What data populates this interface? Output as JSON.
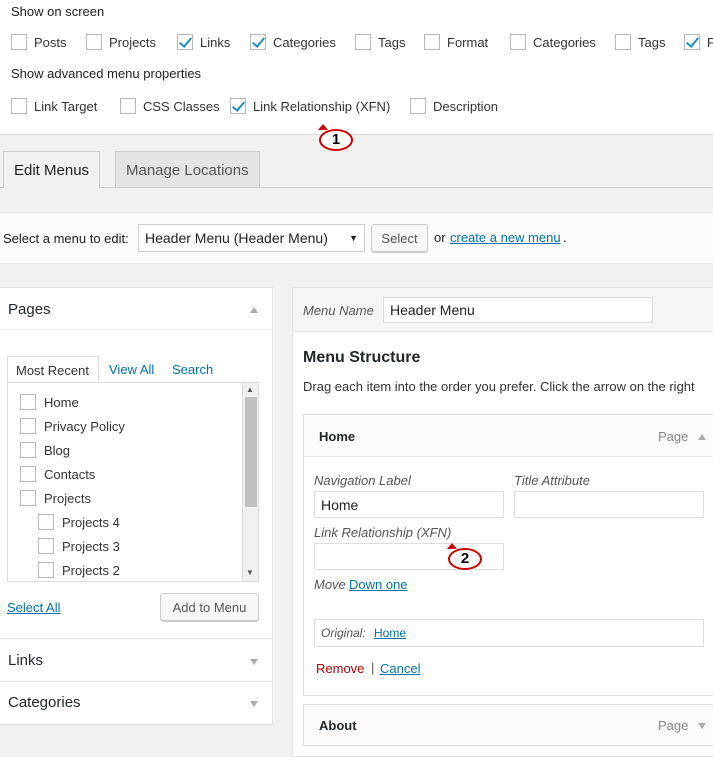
{
  "screen_options": {
    "show_on_screen_heading": "Show on screen",
    "items": [
      {
        "label": "Posts",
        "checked": false
      },
      {
        "label": "Projects",
        "checked": false
      },
      {
        "label": "Links",
        "checked": true
      },
      {
        "label": "Categories",
        "checked": true
      },
      {
        "label": "Tags",
        "checked": false
      },
      {
        "label": "Format",
        "checked": false
      },
      {
        "label": "Categories",
        "checked": false
      },
      {
        "label": "Tags",
        "checked": false
      },
      {
        "label": "P",
        "checked": true
      }
    ],
    "advanced_heading": "Show advanced menu properties",
    "advanced_items": [
      {
        "label": "Link Target",
        "checked": false
      },
      {
        "label": "CSS Classes",
        "checked": false
      },
      {
        "label": "Link Relationship (XFN)",
        "checked": true
      },
      {
        "label": "Description",
        "checked": false
      }
    ]
  },
  "callouts": {
    "one": "1",
    "two": "2"
  },
  "tabs": [
    {
      "label": "Edit Menus",
      "active": true
    },
    {
      "label": "Manage Locations",
      "active": false
    }
  ],
  "manage": {
    "select_label": "Select a menu to edit:",
    "selected_menu": "Header Menu (Header Menu)",
    "select_button": "Select",
    "or_text": "or",
    "create_link": "create a new menu",
    "period": "."
  },
  "left_panel": {
    "pages_title": "Pages",
    "inner_tabs": [
      "Most Recent",
      "View All",
      "Search"
    ],
    "pages": [
      {
        "label": "Home",
        "indent": false
      },
      {
        "label": "Privacy Policy",
        "indent": false
      },
      {
        "label": "Blog",
        "indent": false
      },
      {
        "label": "Contacts",
        "indent": false
      },
      {
        "label": "Projects",
        "indent": false
      },
      {
        "label": "Projects 4",
        "indent": true
      },
      {
        "label": "Projects 3",
        "indent": true
      },
      {
        "label": "Projects 2",
        "indent": true
      }
    ],
    "select_all": "Select All",
    "add_to_menu": "Add to Menu",
    "links_title": "Links",
    "categories_title": "Categories"
  },
  "right_panel": {
    "menu_name_label": "Menu Name",
    "menu_name_value": "Header Menu",
    "structure_title": "Menu Structure",
    "structure_desc": "Drag each item into the order you prefer. Click the arrow on the right",
    "item_home": {
      "title": "Home",
      "type": "Page",
      "nav_label_label": "Navigation Label",
      "nav_label_value": "Home",
      "title_attr_label": "Title Attribute",
      "title_attr_value": "",
      "xfn_label": "Link Relationship (XFN)",
      "xfn_value": "",
      "move_label": "Move",
      "move_link": "Down one",
      "original_label": "Original:",
      "original_link": "Home",
      "remove": "Remove",
      "separator": "|",
      "cancel": "Cancel"
    },
    "item_about": {
      "title": "About",
      "type": "Page"
    }
  }
}
